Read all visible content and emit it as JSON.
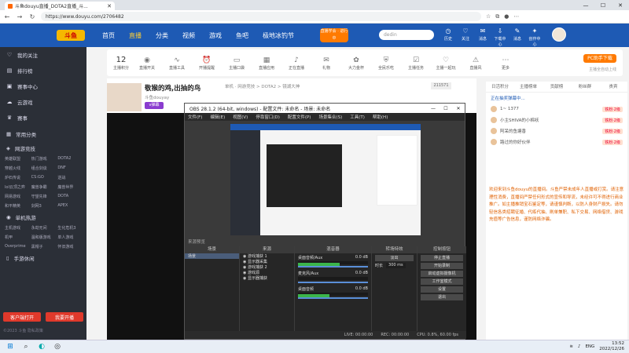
{
  "browser": {
    "tab_title": "斗鱼douyu直播_DOTA2直播_斗...",
    "url": "https://www.douyu.com/2706482",
    "window_controls": [
      "—",
      "☐",
      "✕"
    ]
  },
  "site": {
    "logo": "斗鱼",
    "nav": [
      "首页",
      "直播",
      "分类",
      "视频",
      "游戏",
      "鱼吧",
      "极地冰钓节"
    ],
    "active_nav": "直播",
    "live_button": "直播学会 · 进行中",
    "search_placeholder": "dedin",
    "top_icons": [
      {
        "icon": "history-icon",
        "glyph": "◷",
        "label": "历史"
      },
      {
        "icon": "follow-icon",
        "glyph": "♡",
        "label": "关注"
      },
      {
        "icon": "mail-icon",
        "glyph": "✉",
        "label": "消息"
      },
      {
        "icon": "download-icon",
        "glyph": "⇩",
        "label": "下载中心"
      },
      {
        "icon": "message-icon",
        "glyph": "✎",
        "label": "消息"
      },
      {
        "icon": "creator-icon",
        "glyph": "✦",
        "label": "创作中心"
      }
    ]
  },
  "sidebar": {
    "top_items": [
      {
        "icon": "heart-icon",
        "glyph": "♡",
        "label": "我的关注"
      },
      {
        "icon": "rank-icon",
        "glyph": "▤",
        "label": "排行榜"
      },
      {
        "icon": "channel-icon",
        "glyph": "▣",
        "label": "赛事中心"
      },
      {
        "icon": "cloud-icon",
        "glyph": "☁",
        "label": "云游戏"
      },
      {
        "icon": "trophy-icon",
        "glyph": "♛",
        "label": "赛事"
      }
    ],
    "sections": [
      {
        "title": "常用分类",
        "items": []
      },
      {
        "title": "网游竞技",
        "items": [
          "英雄联盟",
          "热门游戏",
          "DOTA2",
          "穿越火线",
          "组合剑谈",
          "DNF",
          "炉石传说",
          "CS:GO",
          "逆战",
          "lol云顶之弈",
          "魔兽争霸",
          "魔兽世界",
          "网易游戏",
          "守望先锋",
          "DOTA",
          "和平精英",
          "剑网3",
          "APEX"
        ]
      },
      {
        "title": "单机热游",
        "items": [
          "主机游戏",
          "永劫无间",
          "生化危机3",
          "机甲",
          "温和版游戏",
          "单人游戏",
          "Overprime",
          "黑帽子",
          "怀旧游戏"
        ]
      },
      {
        "title": "手游休闲",
        "items": []
      }
    ],
    "buttons": [
      "客户端打开",
      "我要开播"
    ],
    "footer": "©2023 斗鱼 隐私政策"
  },
  "toolbar": {
    "count": "12",
    "count_label": "主播积分",
    "items": [
      {
        "icon": "live-icon",
        "glyph": "◉",
        "label": "直播开关"
      },
      {
        "icon": "pulse-icon",
        "glyph": "∿",
        "label": "直播工具"
      },
      {
        "icon": "alarm-icon",
        "glyph": "⏰",
        "label": "开播提醒"
      },
      {
        "icon": "tv-icon",
        "glyph": "▭",
        "label": "主播口袋"
      },
      {
        "icon": "app-icon",
        "glyph": "▦",
        "label": "直播应用"
      },
      {
        "icon": "voice-icon",
        "glyph": "♪",
        "label": "正在直播"
      },
      {
        "icon": "gift-icon",
        "glyph": "✉",
        "label": "礼物"
      },
      {
        "icon": "flame-icon",
        "glyph": "✿",
        "label": "大力金杯"
      },
      {
        "icon": "shield-icon",
        "glyph": "⛨",
        "label": "全民乐吃"
      },
      {
        "icon": "task-icon",
        "glyph": "☑",
        "label": "主播任务"
      },
      {
        "icon": "fans-icon",
        "glyph": "♡",
        "label": "主播一起玩"
      },
      {
        "icon": "warn-icon",
        "glyph": "⚠",
        "label": "直播风"
      },
      {
        "icon": "more-icon",
        "glyph": "⋯",
        "label": "更多"
      }
    ],
    "pc_button": "PC助手下载",
    "pc_sub": "主播全自动上线"
  },
  "room": {
    "title": "敬猴的鸡,出抽的鸟",
    "meta": "单机 · 网游竞技 > DOTA2 > 镜湖大神",
    "author": "斗鱼douyay",
    "viewers": "211571",
    "badge": "v弹幕"
  },
  "chat": {
    "tabs": [
      "日活积分",
      "主播榜单",
      "贡献榜",
      "粉丝群",
      "贵宾"
    ],
    "header": "正在抽奖弹幕中...",
    "rank_rows": [
      {
        "name": "1~ 1377",
        "badge": "铁粉·2级"
      },
      {
        "name": "小主SHIVA的小棉袄",
        "badge": "铁粉·2级"
      },
      {
        "name": "阿呆的鱼塘香",
        "badge": "铁粉·2级"
      },
      {
        "name": "路过的你好伙伴",
        "badge": "铁粉·2级"
      }
    ],
    "notice": "欢迎来到斗鱼douyu的直播间。斗鱼严禁未成年人直播或打赏。请注意理性消费，直播间严禁任何形式的宣传和导流，未经许可不得进行商业推广。如主播推销宝石鉴定等，请谨慎判断，以防人身财产损失。请勿轻信各类招聘征婚、代练代抽、刷单兼职、私下交易、网络借贷、游戏充值等广告信息，谨防网络诈骗。"
  },
  "obs": {
    "title": "OBS 28.1.2 (64-bit, windows) - 配置文件: 未命名 - 场景: 未命名",
    "menu": [
      "文件(F)",
      "编辑(E)",
      "视图(V)",
      "停靠窗口(D)",
      "配置文件(P)",
      "场景集合(S)",
      "工具(T)",
      "帮助(H)"
    ],
    "preview_label": "来源预览",
    "scene_panel": {
      "title": "场景",
      "items": [
        "场景"
      ]
    },
    "source_panel": {
      "title": "来源",
      "items": [
        "游戏捕获 1",
        "显示器采集",
        "游戏捕获 2",
        "游戏源",
        "显示器捕获"
      ]
    },
    "mixer_panel": {
      "title": "混音器",
      "tracks": [
        {
          "name": "桌面音频/Aux",
          "db": "0.0 dB",
          "level": 0.6
        },
        {
          "name": "麦克风/Aux",
          "db": "0.0 dB",
          "level": 0.0
        },
        {
          "name": "桌面音频",
          "db": "0.0 dB",
          "level": 0.45
        }
      ]
    },
    "transition_panel": {
      "title": "转场特效",
      "type": "淡出",
      "duration_label": "时长",
      "duration": "300 ms"
    },
    "controls_panel": {
      "title": "控制按钮",
      "buttons": [
        "停止直播",
        "开始录制",
        "启动虚拟摄像机",
        "工作室模式",
        "设置",
        "退出"
      ]
    },
    "status": [
      "LIVE: 00:00:00",
      "REC: 00:00:00",
      "CPU: 0.8%, 60.00 fps"
    ]
  },
  "taskbar": {
    "lang": "ENG",
    "time": "13:52",
    "date": "2022/12/26"
  }
}
